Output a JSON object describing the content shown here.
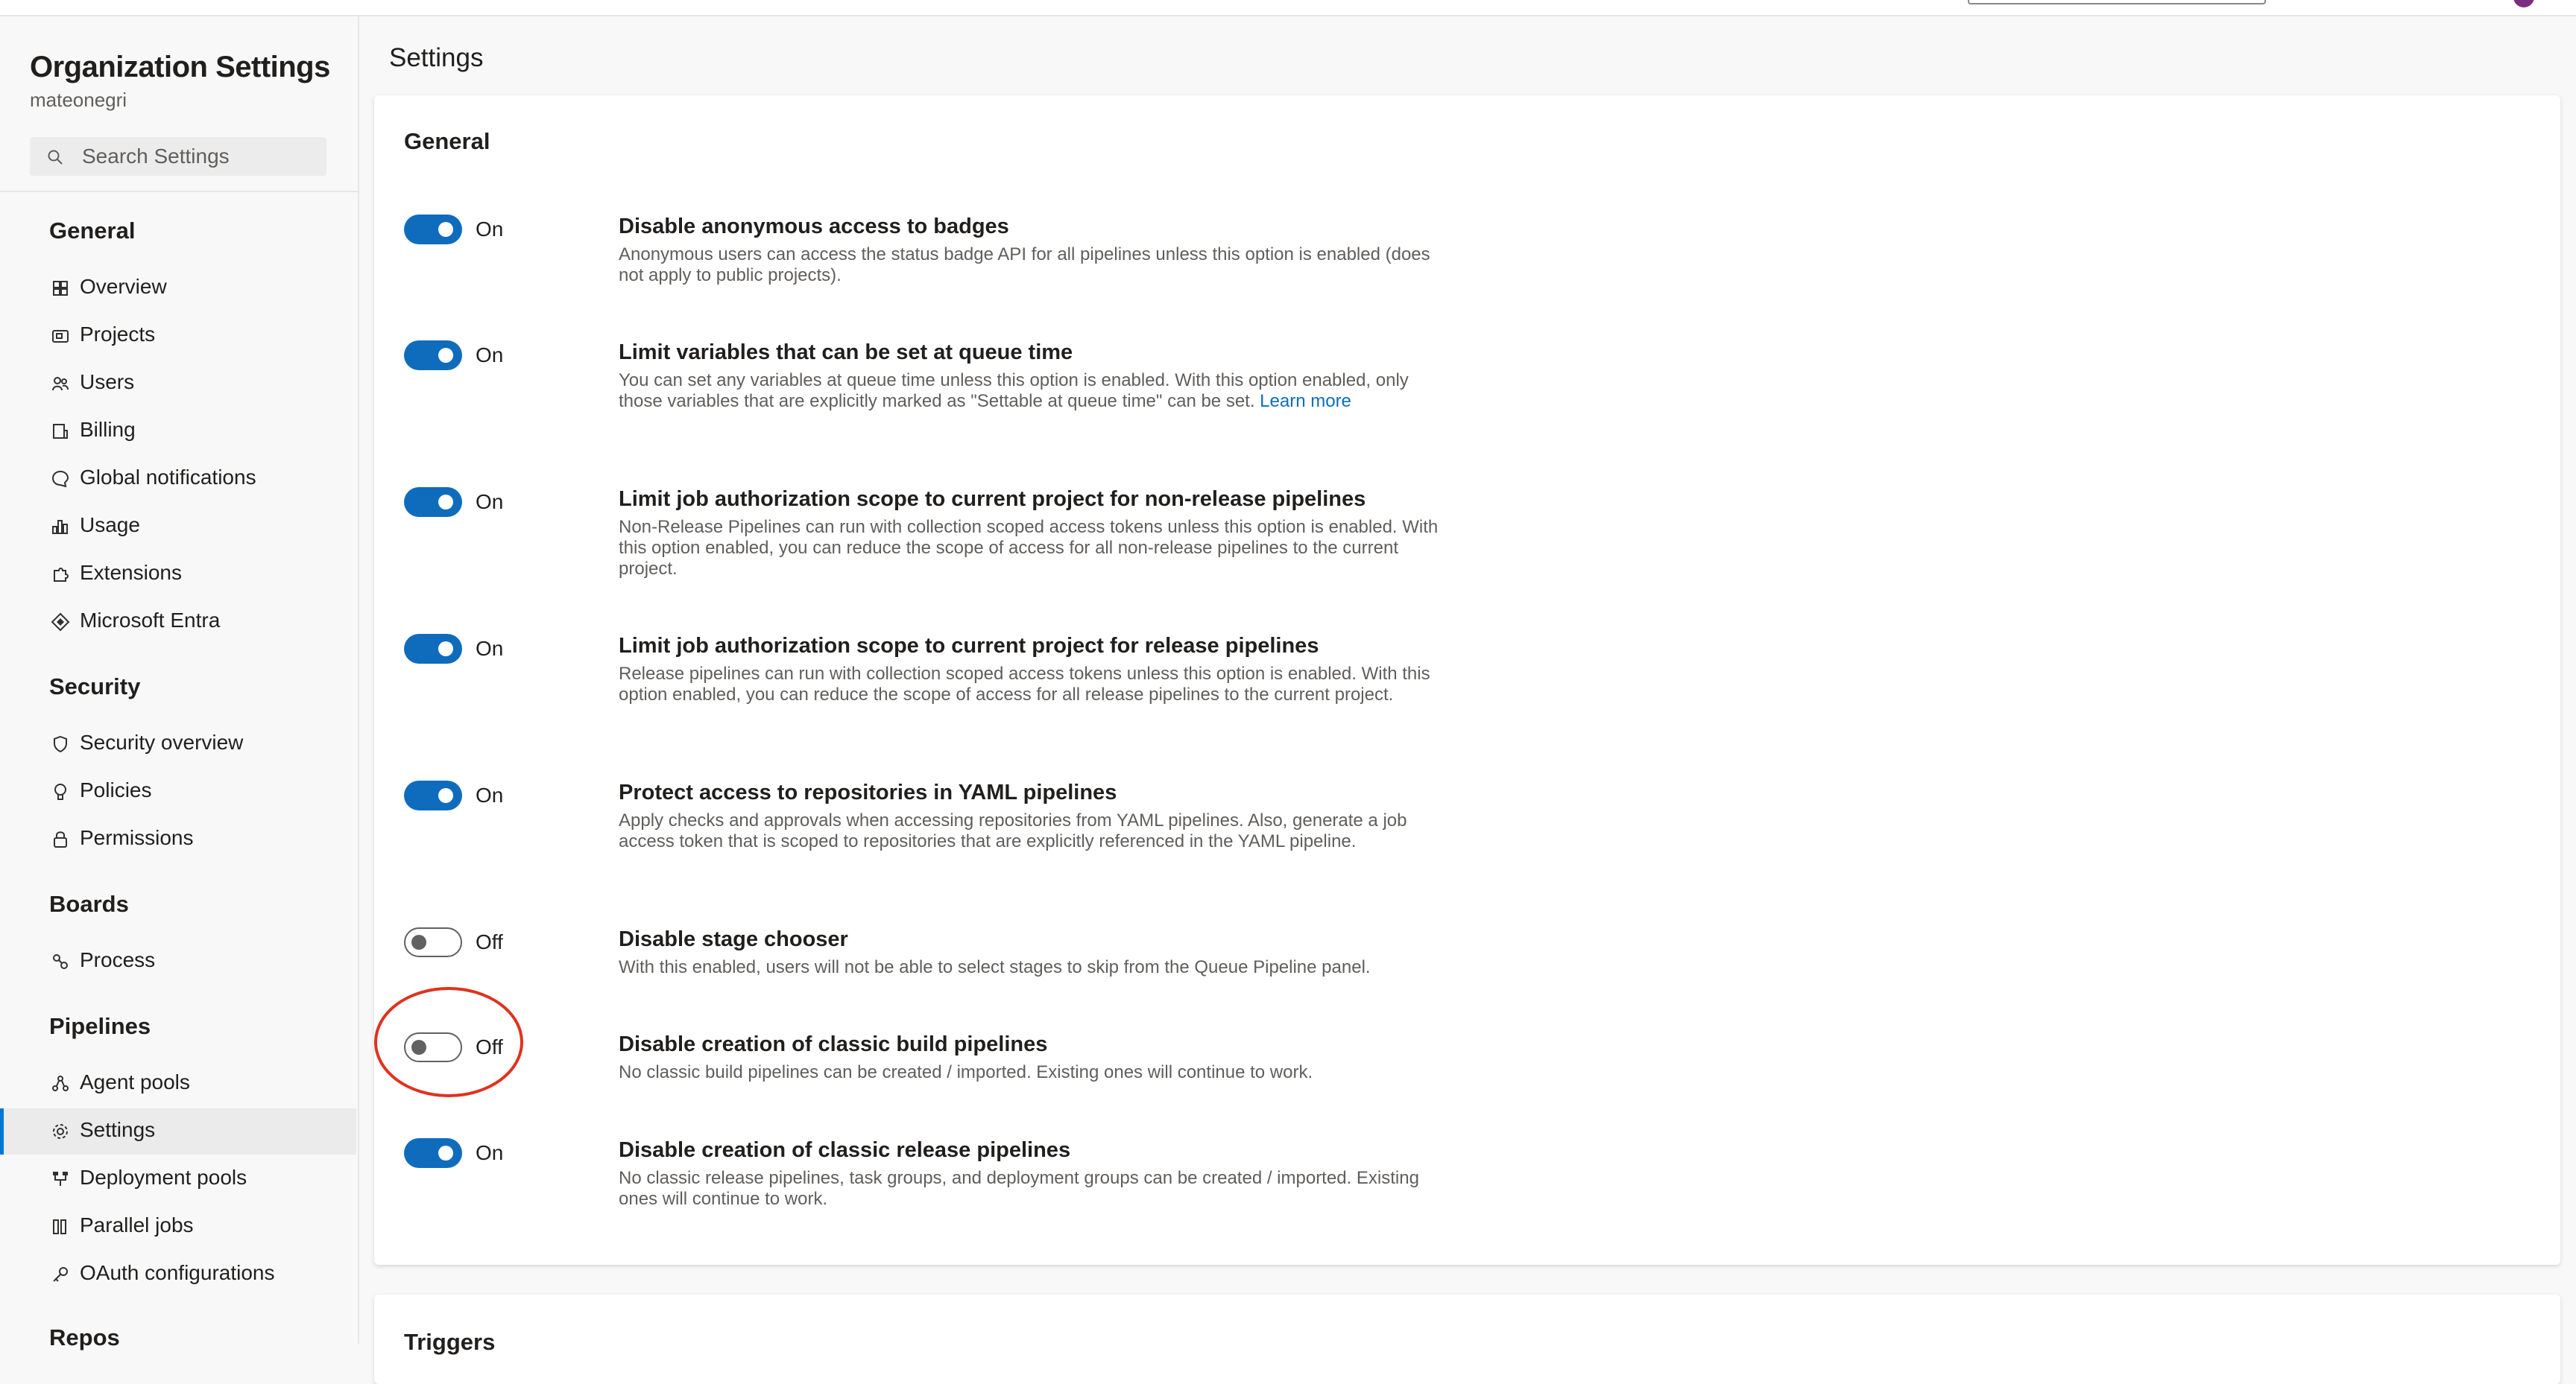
{
  "sidebar": {
    "org_title": "Organization Settings",
    "org_name": "mateonegri",
    "search_placeholder": "Search Settings",
    "sections": [
      {
        "header": "General",
        "items": [
          {
            "label": "Overview",
            "icon": "overview-icon"
          },
          {
            "label": "Projects",
            "icon": "projects-icon"
          },
          {
            "label": "Users",
            "icon": "users-icon"
          },
          {
            "label": "Billing",
            "icon": "billing-icon"
          },
          {
            "label": "Global notifications",
            "icon": "notifications-icon"
          },
          {
            "label": "Usage",
            "icon": "usage-icon"
          },
          {
            "label": "Extensions",
            "icon": "extensions-icon"
          },
          {
            "label": "Microsoft Entra",
            "icon": "entra-icon"
          }
        ]
      },
      {
        "header": "Security",
        "items": [
          {
            "label": "Security overview",
            "icon": "shield-icon"
          },
          {
            "label": "Policies",
            "icon": "policies-icon"
          },
          {
            "label": "Permissions",
            "icon": "lock-icon"
          }
        ]
      },
      {
        "header": "Boards",
        "items": [
          {
            "label": "Process",
            "icon": "process-icon"
          }
        ]
      },
      {
        "header": "Pipelines",
        "items": [
          {
            "label": "Agent pools",
            "icon": "agent-pools-icon"
          },
          {
            "label": "Settings",
            "icon": "gear-icon",
            "selected": true
          },
          {
            "label": "Deployment pools",
            "icon": "deployment-pools-icon"
          },
          {
            "label": "Parallel jobs",
            "icon": "parallel-jobs-icon"
          },
          {
            "label": "OAuth configurations",
            "icon": "key-icon"
          }
        ]
      },
      {
        "header": "Repos",
        "items": []
      }
    ]
  },
  "main": {
    "page_title": "Settings",
    "general_card": {
      "title": "General",
      "settings": [
        {
          "state": "On",
          "enabled": true,
          "title": "Disable anonymous access to badges",
          "desc": "Anonymous users can access the status badge API for all pipelines unless this option is enabled (does not apply to public projects)."
        },
        {
          "state": "On",
          "enabled": true,
          "title": "Limit variables that can be set at queue time",
          "desc": "You can set any variables at queue time unless this option is enabled. With this option enabled, only those variables that are explicitly marked as \"Settable at queue time\" can be set.",
          "link": "Learn more"
        },
        {
          "state": "On",
          "enabled": true,
          "title": "Limit job authorization scope to current project for non-release pipelines",
          "desc": "Non-Release Pipelines can run with collection scoped access tokens unless this option is enabled. With this option enabled, you can reduce the scope of access for all non-release pipelines to the current project."
        },
        {
          "state": "On",
          "enabled": true,
          "title": "Limit job authorization scope to current project for release pipelines",
          "desc": "Release pipelines can run with collection scoped access tokens unless this option is enabled. With this option enabled, you can reduce the scope of access for all release pipelines to the current project."
        },
        {
          "state": "On",
          "enabled": true,
          "title": "Protect access to repositories in YAML pipelines",
          "desc": "Apply checks and approvals when accessing repositories from YAML pipelines. Also, generate a job access token that is scoped to repositories that are explicitly referenced in the YAML pipeline."
        },
        {
          "state": "Off",
          "enabled": false,
          "title": "Disable stage chooser",
          "desc": "With this enabled, users will not be able to select stages to skip from the Queue Pipeline panel."
        },
        {
          "state": "Off",
          "enabled": false,
          "title": "Disable creation of classic build pipelines",
          "desc": "No classic build pipelines can be created / imported. Existing ones will continue to work."
        },
        {
          "state": "On",
          "enabled": true,
          "title": "Disable creation of classic release pipelines",
          "desc": "No classic release pipelines, task groups, and deployment groups can be created / imported. Existing ones will continue to work."
        }
      ]
    },
    "triggers_card": {
      "title": "Triggers"
    }
  },
  "colors": {
    "accent": "#0f6cbd",
    "selection_bar": "#0078d4",
    "annotation": "#e0321f"
  }
}
